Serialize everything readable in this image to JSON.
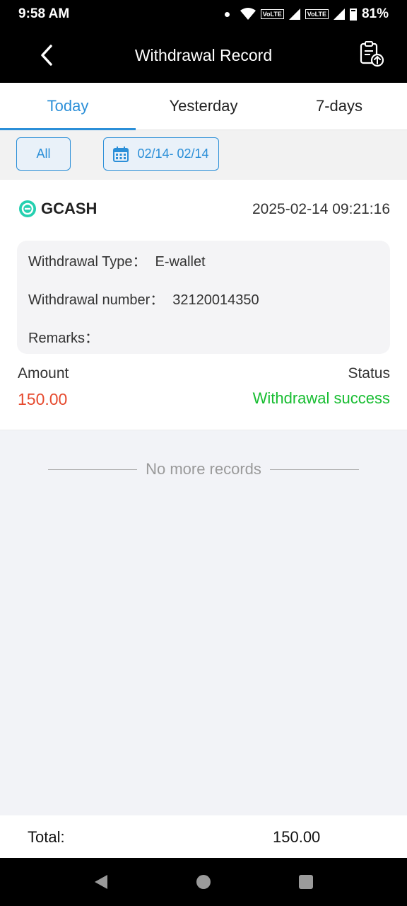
{
  "status_bar": {
    "time": "9:58 AM",
    "volte_1": "VoLTE",
    "volte_2": "VoLTE",
    "battery": "81%"
  },
  "header": {
    "title": "Withdrawal Record",
    "back_icon": "chevron-left-icon",
    "export_icon": "clipboard-upload-icon"
  },
  "tabs": [
    {
      "label": "Today",
      "active": true
    },
    {
      "label": "Yesterday",
      "active": false
    },
    {
      "label": "7-days",
      "active": false
    }
  ],
  "filters": {
    "all_label": "All",
    "date_range": "02/14- 02/14",
    "date_icon": "calendar-icon"
  },
  "record": {
    "method": "GCASH",
    "method_icon": "gcash-logo-icon",
    "time": "2025-02-14 09:21:16",
    "type_label": "Withdrawal Type：",
    "type_value": "E-wallet",
    "number_label": "Withdrawal number：",
    "number_value": "32120014350",
    "remarks_label": "Remarks：",
    "remarks_value": "",
    "amount_label": "Amount",
    "amount_value": "150.00",
    "status_label": "Status",
    "status_value": "Withdrawal success"
  },
  "list_end_text": "No more records",
  "footer": {
    "total_label": "Total:",
    "total_value": "150.00"
  },
  "colors": {
    "accent": "#2b8fd8",
    "amount": "#e64a2e",
    "success": "#17bd31"
  }
}
